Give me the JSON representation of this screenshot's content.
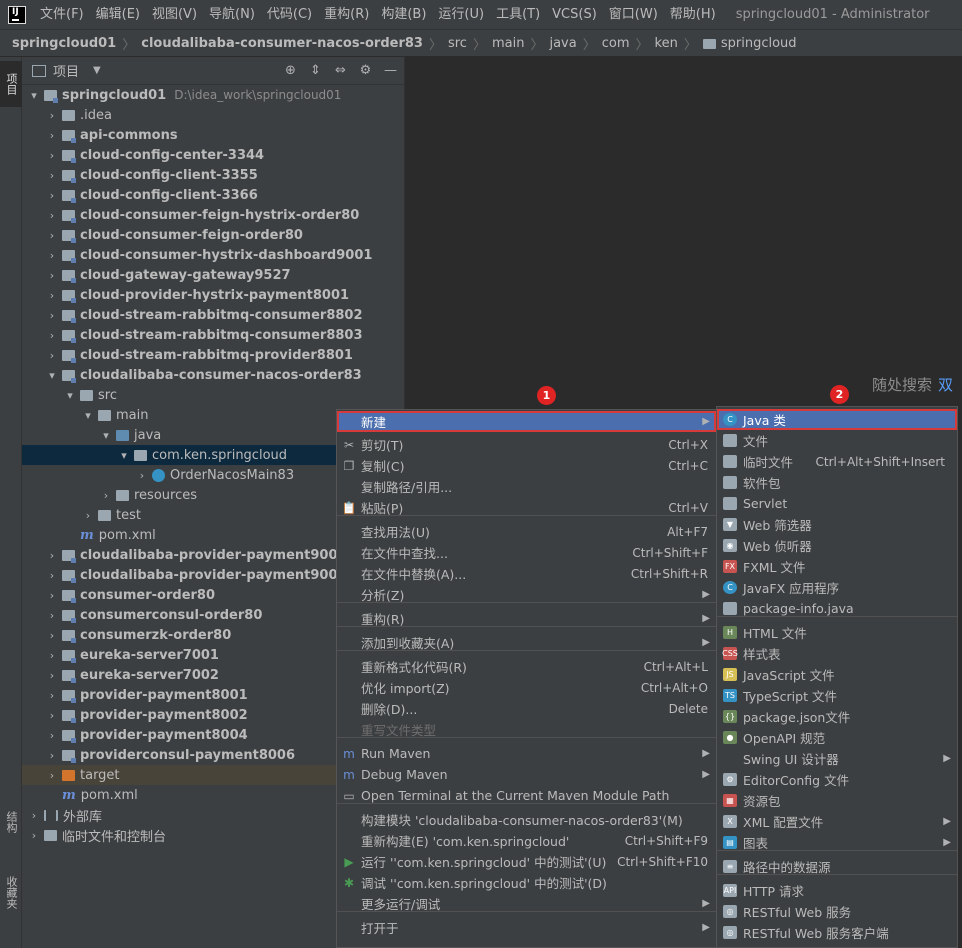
{
  "menubar": {
    "items": [
      "文件(F)",
      "编辑(E)",
      "视图(V)",
      "导航(N)",
      "代码(C)",
      "重构(R)",
      "构建(B)",
      "运行(U)",
      "工具(T)",
      "VCS(S)",
      "窗口(W)",
      "帮助(H)"
    ],
    "window_title": "springcloud01 - Administrator"
  },
  "breadcrumb": [
    "springcloud01",
    "cloudalibaba-consumer-nacos-order83",
    "src",
    "main",
    "java",
    "com",
    "ken",
    "springcloud"
  ],
  "leftstrip": {
    "project_tab": "项目",
    "structure_tab": "结构",
    "favorites_tab": "收藏夹"
  },
  "panel": {
    "title": "项目"
  },
  "tree": {
    "root_name": "springcloud01",
    "root_path": "D:\\idea_work\\springcloud01",
    "modules_top": [
      ".idea",
      "api-commons",
      "cloud-config-center-3344",
      "cloud-config-client-3355",
      "cloud-config-client-3366",
      "cloud-consumer-feign-hystrix-order80",
      "cloud-consumer-feign-order80",
      "cloud-consumer-hystrix-dashboard9001",
      "cloud-gateway-gateway9527",
      "cloud-provider-hystrix-payment8001",
      "cloud-stream-rabbitmq-consumer8802",
      "cloud-stream-rabbitmq-consumer8803",
      "cloud-stream-rabbitmq-provider8801",
      "cloudalibaba-consumer-nacos-order83"
    ],
    "src": "src",
    "main": "main",
    "java": "java",
    "package": "com.ken.springcloud",
    "main_class": "OrderNacosMain83",
    "resources": "resources",
    "test": "test",
    "pom": "pom.xml",
    "modules_bottom": [
      "cloudalibaba-provider-payment9001",
      "cloudalibaba-provider-payment9002",
      "consumer-order80",
      "consumerconsul-order80",
      "consumerzk-order80",
      "eureka-server7001",
      "eureka-server7002",
      "provider-payment8001",
      "provider-payment8002",
      "provider-payment8004",
      "providerconsul-payment8006"
    ],
    "target": "target",
    "root_pom": "pom.xml",
    "external_libs": "外部库",
    "scratches": "临时文件和控制台"
  },
  "editor": {
    "search_hint": "随处搜索",
    "search_key": "双"
  },
  "context_menu": {
    "items": [
      {
        "label": "新建",
        "shortcut": "",
        "submenu": true
      },
      {
        "label": "剪切(T)",
        "shortcut": "Ctrl+X",
        "icon": "scissors-icon"
      },
      {
        "label": "复制(C)",
        "shortcut": "Ctrl+C",
        "icon": "copy-icon"
      },
      {
        "label": "复制路径/引用...",
        "shortcut": ""
      },
      {
        "label": "粘贴(P)",
        "shortcut": "Ctrl+V",
        "icon": "paste-icon"
      },
      {
        "label": "查找用法(U)",
        "shortcut": "Alt+F7"
      },
      {
        "label": "在文件中查找...",
        "shortcut": "Ctrl+Shift+F"
      },
      {
        "label": "在文件中替换(A)...",
        "shortcut": "Ctrl+Shift+R"
      },
      {
        "label": "分析(Z)",
        "shortcut": "",
        "submenu": true
      },
      {
        "label": "重构(R)",
        "shortcut": "",
        "submenu": true
      },
      {
        "label": "添加到收藏夹(A)",
        "shortcut": "",
        "submenu": true
      },
      {
        "label": "重新格式化代码(R)",
        "shortcut": "Ctrl+Alt+L"
      },
      {
        "label": "优化 import(Z)",
        "shortcut": "Ctrl+Alt+O"
      },
      {
        "label": "删除(D)...",
        "shortcut": "Delete"
      },
      {
        "label": "重写文件类型",
        "shortcut": "",
        "disabled": true
      },
      {
        "label": "Run Maven",
        "shortcut": "",
        "icon": "maven-run-icon",
        "submenu": true
      },
      {
        "label": "Debug Maven",
        "shortcut": "",
        "icon": "maven-debug-icon",
        "submenu": true
      },
      {
        "label": "Open Terminal at the Current Maven Module Path",
        "shortcut": "",
        "icon": "terminal-icon"
      },
      {
        "label": "构建模块 'cloudalibaba-consumer-nacos-order83'(M)",
        "shortcut": ""
      },
      {
        "label": "重新构建(E) 'com.ken.springcloud'",
        "shortcut": "Ctrl+Shift+F9"
      },
      {
        "label": "运行 ''com.ken.springcloud' 中的测试'(U)",
        "shortcut": "Ctrl+Shift+F10",
        "icon": "run-icon"
      },
      {
        "label": "调试 ''com.ken.springcloud' 中的测试'(D)",
        "shortcut": "",
        "icon": "debug-icon"
      },
      {
        "label": "更多运行/调试",
        "shortcut": "",
        "submenu": true
      },
      {
        "label": "打开于",
        "shortcut": "",
        "submenu": true
      }
    ]
  },
  "submenu": {
    "items": [
      {
        "label": "Java 类",
        "shortcut": "",
        "color": "#3592c4",
        "glyph": "C"
      },
      {
        "label": "文件",
        "shortcut": "",
        "color": "#9aa7b0",
        "glyph": ""
      },
      {
        "label": "临时文件",
        "shortcut": "Ctrl+Alt+Shift+Insert",
        "color": "#9aa7b0",
        "glyph": ""
      },
      {
        "label": "软件包",
        "shortcut": "",
        "color": "#9aa7b0",
        "glyph": ""
      },
      {
        "label": "Servlet",
        "shortcut": "",
        "color": "#9aa7b0",
        "glyph": ""
      },
      {
        "label": "Web 筛选器",
        "shortcut": "",
        "color": "#9aa7b0",
        "glyph": "▼"
      },
      {
        "label": "Web 侦听器",
        "shortcut": "",
        "color": "#9aa7b0",
        "glyph": "◉"
      },
      {
        "label": "FXML 文件",
        "shortcut": "",
        "color": "#c75450",
        "glyph": "FX"
      },
      {
        "label": "JavaFX 应用程序",
        "shortcut": "",
        "color": "#3592c4",
        "glyph": "C"
      },
      {
        "label": "package-info.java",
        "shortcut": "",
        "color": "#9aa7b0",
        "glyph": ""
      },
      {
        "label": "HTML 文件",
        "shortcut": "",
        "color": "#6a8759",
        "glyph": "H"
      },
      {
        "label": "样式表",
        "shortcut": "",
        "color": "#c75450",
        "glyph": "CSS"
      },
      {
        "label": "JavaScript 文件",
        "shortcut": "",
        "color": "#d6bf55",
        "glyph": "JS"
      },
      {
        "label": "TypeScript 文件",
        "shortcut": "",
        "color": "#3592c4",
        "glyph": "TS"
      },
      {
        "label": "package.json文件",
        "shortcut": "",
        "color": "#6a8759",
        "glyph": "{}"
      },
      {
        "label": "OpenAPI 规范",
        "shortcut": "",
        "color": "#6a8759",
        "glyph": "●"
      },
      {
        "label": "Swing UI 设计器",
        "shortcut": "",
        "color": "#3c3f41",
        "glyph": "",
        "submenu": true
      },
      {
        "label": "EditorConfig 文件",
        "shortcut": "",
        "color": "#9aa7b0",
        "glyph": "⚙"
      },
      {
        "label": "资源包",
        "shortcut": "",
        "color": "#c75450",
        "glyph": "▦"
      },
      {
        "label": "XML 配置文件",
        "shortcut": "",
        "color": "#9aa7b0",
        "glyph": "X",
        "submenu": true
      },
      {
        "label": "图表",
        "shortcut": "",
        "color": "#3592c4",
        "glyph": "▤",
        "submenu": true
      },
      {
        "label": "路径中的数据源",
        "shortcut": "",
        "color": "#9aa7b0",
        "glyph": "≡"
      },
      {
        "label": "HTTP 请求",
        "shortcut": "",
        "color": "#9aa7b0",
        "glyph": "API"
      },
      {
        "label": "RESTful Web 服务",
        "shortcut": "",
        "color": "#9aa7b0",
        "glyph": "◎"
      },
      {
        "label": "RESTful Web 服务客户端",
        "shortcut": "",
        "color": "#9aa7b0",
        "glyph": "◎"
      }
    ]
  },
  "badges": [
    "1",
    "2"
  ]
}
